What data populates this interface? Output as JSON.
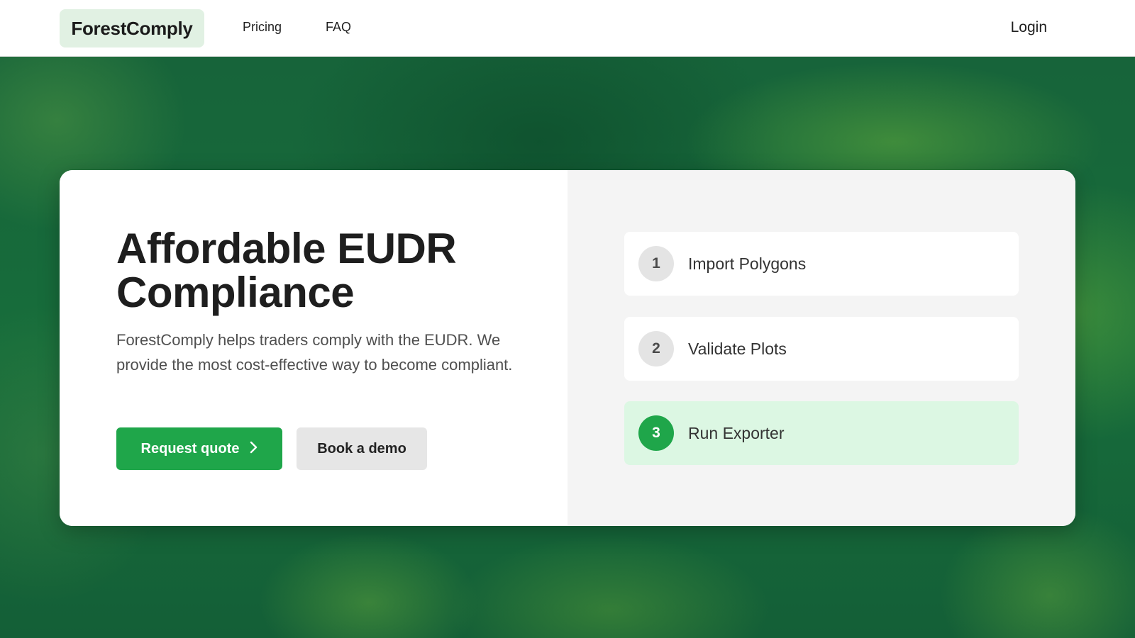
{
  "header": {
    "brand": "ForestComply",
    "nav": [
      {
        "label": "Pricing"
      },
      {
        "label": "FAQ"
      }
    ],
    "login_label": "Login"
  },
  "hero": {
    "title": "Affordable EUDR Compliance",
    "subtitle": "ForestComply helps traders comply with the EUDR. We provide the most cost-effective way to become compliant.",
    "primary_button": {
      "label": "Request quote",
      "icon": "chevron-right-icon"
    },
    "secondary_button": {
      "label": "Book a demo"
    }
  },
  "steps": [
    {
      "number": "1",
      "label": "Import Polygons",
      "active": false
    },
    {
      "number": "2",
      "label": "Validate Plots",
      "active": false
    },
    {
      "number": "3",
      "label": "Run Exporter",
      "active": true
    }
  ],
  "colors": {
    "accent": "#1fa64a",
    "brand_bg": "#e1f1e3",
    "active_step_bg": "#dcf7e3",
    "hero_bg": "#15663a"
  }
}
